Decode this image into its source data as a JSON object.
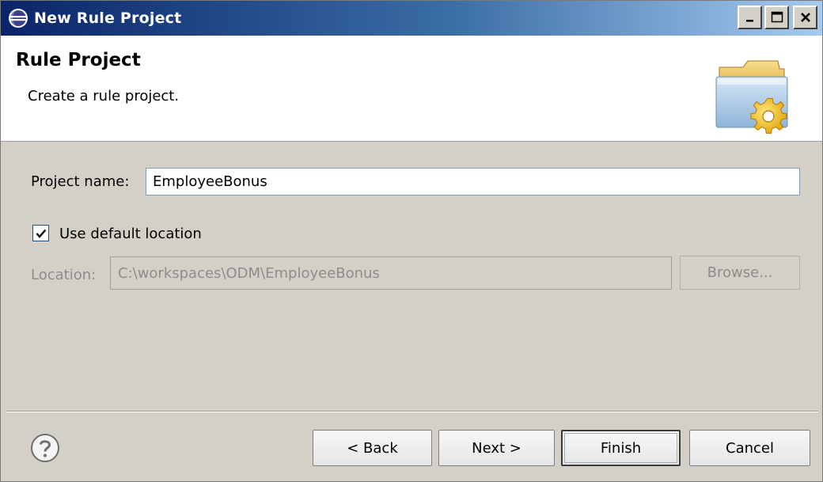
{
  "window": {
    "title": "New Rule Project",
    "controls": {
      "minimize_icon": "minimize-icon",
      "maximize_icon": "maximize-icon",
      "close_icon": "close-icon"
    }
  },
  "banner": {
    "title": "Rule Project",
    "description": "Create a rule project.",
    "image_icon": "folder-gear-icon"
  },
  "form": {
    "project_name_label": "Project name:",
    "project_name_value": "EmployeeBonus",
    "use_default_location_label": "Use default location",
    "use_default_location_checked": true,
    "location_label": "Location:",
    "location_value": "C:\\workspaces\\ODM\\EmployeeBonus",
    "browse_label": "Browse..."
  },
  "footer": {
    "help_icon": "help-icon",
    "back_label": "< Back",
    "next_label": "Next >",
    "finish_label": "Finish",
    "cancel_label": "Cancel"
  },
  "colors": {
    "title_bar_start": "#0a246a",
    "title_bar_end": "#a6caf0",
    "dialog_background": "#d4d0c8",
    "disabled_text": "#8d8d8d"
  }
}
